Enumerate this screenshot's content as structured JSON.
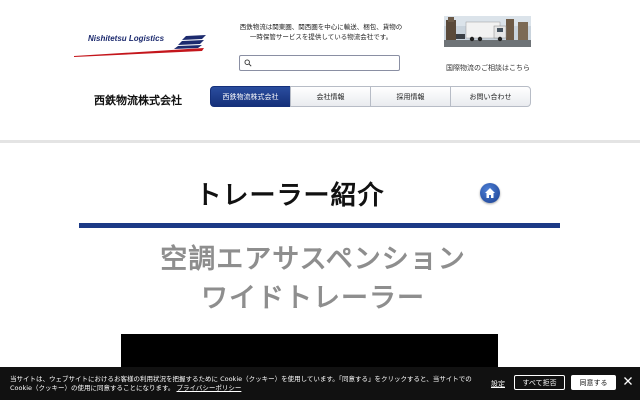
{
  "header": {
    "logo_text": "Nishitetsu Logistics",
    "company_name": "西鉄物流株式会社",
    "tagline_line1": "西鉄物流は関東圏、関西圏を中心に輸送、梱包、貨物の",
    "tagline_line2": "一時保管サービスを提供している物流会社です。",
    "search_placeholder": "",
    "intl_link": "国際物流のご相談はこちら",
    "brand_color": "#1c3a86"
  },
  "nav": {
    "items": [
      {
        "label": "西鉄物流株式会社",
        "active": true
      },
      {
        "label": "会社情報",
        "active": false
      },
      {
        "label": "採用情報",
        "active": false
      },
      {
        "label": "お問い合わせ",
        "active": false
      }
    ]
  },
  "main": {
    "title": "トレーラー紹介",
    "subtitle_line1": "空調エアサスペンション",
    "subtitle_line2": "ワイドトレーラー"
  },
  "cookie": {
    "text": "当サイトは、ウェブサイトにおけるお客様の利用状況を把握するために Cookie（クッキー）を使用しています。「同意する」をクリックすると、当サイトでの Cookie（クッキー）の使用に同意することになります。",
    "privacy_link": "プライバシーポリシー",
    "settings_label": "設定",
    "reject_label": "すべて拒否",
    "accept_label": "同意する"
  },
  "icons": {
    "search": "search-icon",
    "home": "home-icon",
    "close": "close-icon"
  }
}
